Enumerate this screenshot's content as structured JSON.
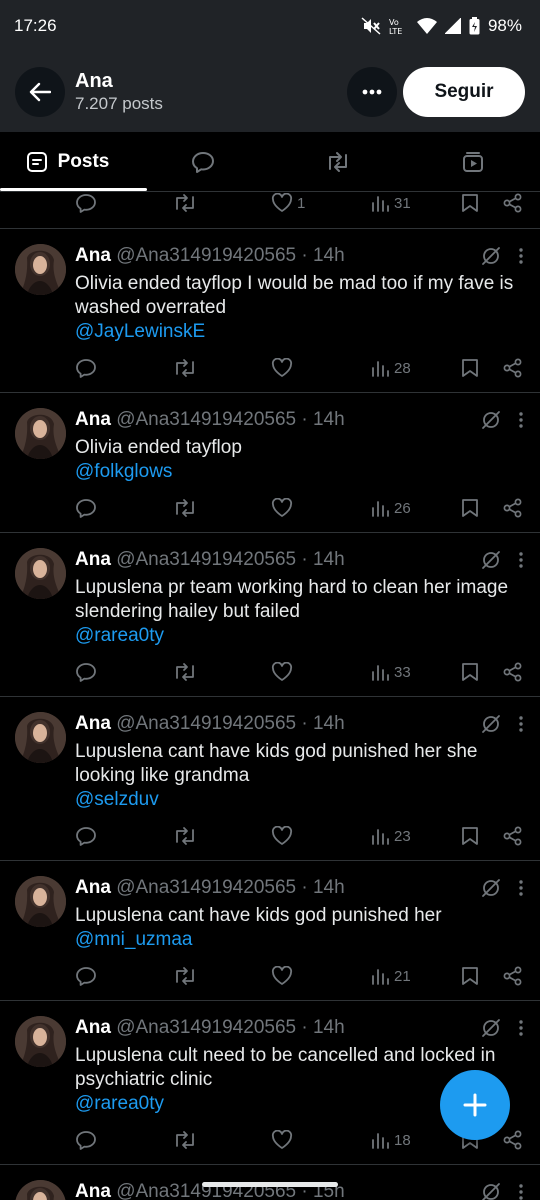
{
  "status_bar": {
    "time": "17:26",
    "network": "LTE",
    "battery": "98%"
  },
  "header": {
    "name": "Ana",
    "post_count": "7.207 posts",
    "follow_label": "Seguir"
  },
  "tabs": [
    {
      "label": "Posts",
      "icon": "posts-icon",
      "active": true
    },
    {
      "label": "",
      "icon": "replies-icon",
      "active": false
    },
    {
      "label": "",
      "icon": "reposts-icon",
      "active": false
    },
    {
      "label": "",
      "icon": "media-icon",
      "active": false
    }
  ],
  "partial_top_post": {
    "likes": "1",
    "views": "31"
  },
  "posts": [
    {
      "name": "Ana",
      "handle": "@Ana314919420565",
      "time": "14h",
      "text": "Olivia ended tayflop I would be mad too if my fave is washed overrated",
      "mention": "@JayLewinskE",
      "views": "28"
    },
    {
      "name": "Ana",
      "handle": "@Ana314919420565",
      "time": "14h",
      "text": "Olivia ended tayflop",
      "mention": "@folkglows",
      "views": "26"
    },
    {
      "name": "Ana",
      "handle": "@Ana314919420565",
      "time": "14h",
      "text": "Lupuslena pr team working hard to clean her image slendering hailey but failed",
      "mention": "@rarea0ty",
      "views": "33"
    },
    {
      "name": "Ana",
      "handle": "@Ana314919420565",
      "time": "14h",
      "text": "Lupuslena cant have kids god punished her she looking like grandma",
      "mention": "@selzduv",
      "views": "23"
    },
    {
      "name": "Ana",
      "handle": "@Ana314919420565",
      "time": "14h",
      "text": "Lupuslena cant have kids god punished her",
      "mention": "@mni_uzmaa",
      "views": "21"
    },
    {
      "name": "Ana",
      "handle": "@Ana314919420565",
      "time": "14h",
      "text": "Lupuslena cult need to be cancelled and locked in psychiatric clinic",
      "mention": "@rarea0ty",
      "views": "18"
    },
    {
      "name": "Ana",
      "handle": "@Ana314919420565",
      "time": "15h",
      "text": "",
      "mention": "",
      "views": ""
    }
  ],
  "colors": {
    "accent": "#1d9bf0",
    "background": "#000000",
    "header_bg": "#202327",
    "muted": "#71767b"
  }
}
